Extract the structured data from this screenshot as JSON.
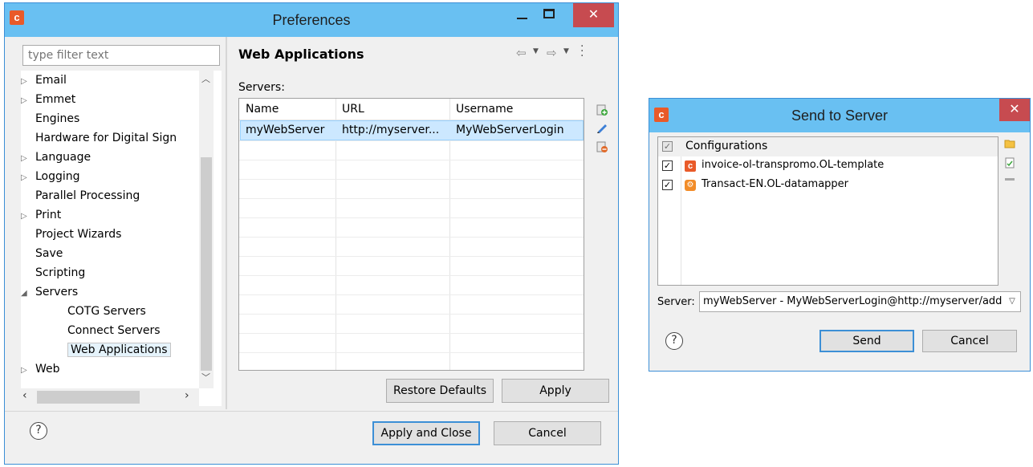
{
  "preferences": {
    "title": "Preferences",
    "filter_placeholder": "type filter text",
    "tree_items": [
      {
        "label": "Email",
        "expander": "▷",
        "indent": 0
      },
      {
        "label": "Emmet",
        "expander": "▷",
        "indent": 0
      },
      {
        "label": "Engines",
        "expander": "",
        "indent": 0
      },
      {
        "label": "Hardware for Digital Sign",
        "expander": "",
        "indent": 0
      },
      {
        "label": "Language",
        "expander": "▷",
        "indent": 0
      },
      {
        "label": "Logging",
        "expander": "▷",
        "indent": 0
      },
      {
        "label": "Parallel Processing",
        "expander": "",
        "indent": 0
      },
      {
        "label": "Print",
        "expander": "▷",
        "indent": 0
      },
      {
        "label": "Project Wizards",
        "expander": "",
        "indent": 0
      },
      {
        "label": "Save",
        "expander": "",
        "indent": 0
      },
      {
        "label": "Scripting",
        "expander": "",
        "indent": 0
      },
      {
        "label": "Servers",
        "expander": "◢",
        "indent": 0
      },
      {
        "label": "COTG Servers",
        "expander": "",
        "indent": 1
      },
      {
        "label": "Connect Servers",
        "expander": "",
        "indent": 1
      },
      {
        "label": "Web Applications",
        "expander": "",
        "indent": 1,
        "selected": true
      },
      {
        "label": "Web",
        "expander": "▷",
        "indent": 0
      }
    ],
    "page_heading": "Web Applications",
    "servers_label": "Servers:",
    "columns": [
      "Name",
      "URL",
      "Username"
    ],
    "rows": [
      [
        "myWebServer",
        "http://myserver...",
        "MyWebServerLogin"
      ]
    ],
    "restore_defaults": "Restore Defaults",
    "apply": "Apply",
    "apply_and_close": "Apply and Close",
    "cancel": "Cancel",
    "help": "?"
  },
  "send": {
    "title": "Send to Server",
    "header": "Configurations",
    "items": [
      {
        "label": "invoice-ol-transpromo.OL-template",
        "icon": "template-icon",
        "checked": true
      },
      {
        "label": "Transact-EN.OL-datamapper",
        "icon": "datamapper-icon",
        "checked": true
      }
    ],
    "server_label": "Server:",
    "server_value": "myWebServer - MyWebServerLogin@http://myserver/add",
    "send_btn": "Send",
    "cancel_btn": "Cancel",
    "help": "?"
  },
  "colors": {
    "titlebar": "#69c0f2",
    "border": "#3c8fd6",
    "close": "#c74b50",
    "selection": "#cce8ff",
    "brand": "#e95a29"
  }
}
